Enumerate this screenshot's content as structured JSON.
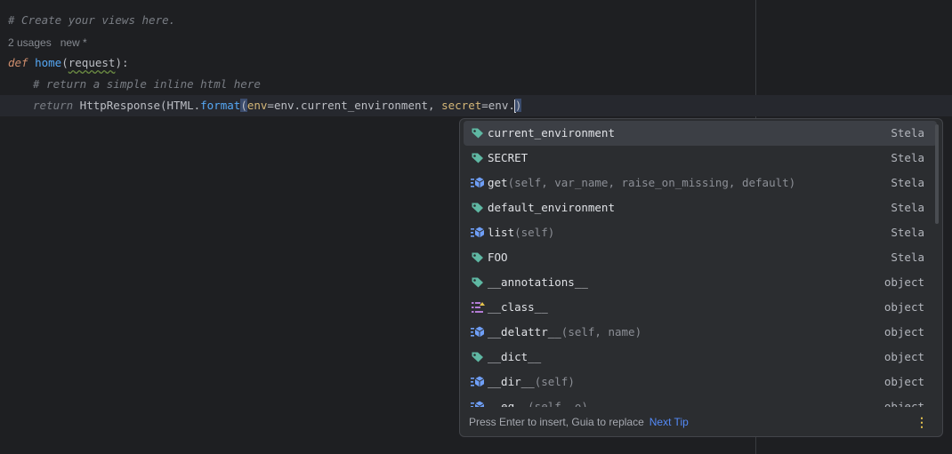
{
  "editor": {
    "line1_comment": "# Create your views here.",
    "inlay": {
      "usages": "2 usages",
      "status": "new *"
    },
    "line3": {
      "kw": "def",
      "fn": "home",
      "open": "(",
      "param": "request",
      "close": "):"
    },
    "line4_comment": "# return a simple inline html here",
    "line5": {
      "kw": "return",
      "p1": " HttpResponse(HTML.",
      "meth": "format",
      "paren": "(",
      "arg1_name": "env",
      "arg1_val": "=env.current_environment, ",
      "arg2_name": "secret",
      "arg2_val": "=env.",
      "close": ")"
    }
  },
  "completion": {
    "items": [
      {
        "name": "current_environment",
        "sig": "",
        "source": "Stela",
        "icon": "tag-icon"
      },
      {
        "name": "SECRET",
        "sig": "",
        "source": "Stela",
        "icon": "tag-icon"
      },
      {
        "name": "get",
        "sig": "(self, var_name, raise_on_missing, default)",
        "source": "Stela",
        "icon": "method-icon"
      },
      {
        "name": "default_environment",
        "sig": "",
        "source": "Stela",
        "icon": "tag-icon"
      },
      {
        "name": "list",
        "sig": "(self)",
        "source": "Stela",
        "icon": "method-icon"
      },
      {
        "name": "FOO",
        "sig": "",
        "source": "Stela",
        "icon": "tag-icon"
      },
      {
        "name": "__annotations__",
        "sig": "",
        "source": "object",
        "icon": "tag-icon"
      },
      {
        "name": "__class__",
        "sig": "",
        "source": "object",
        "icon": "class-icon"
      },
      {
        "name": "__delattr__",
        "sig": "(self, name)",
        "source": "object",
        "icon": "method-icon"
      },
      {
        "name": "__dict__",
        "sig": "",
        "source": "object",
        "icon": "tag-icon"
      },
      {
        "name": "__dir__",
        "sig": "(self)",
        "source": "object",
        "icon": "method-icon"
      },
      {
        "name": "__eq__",
        "sig": "(self, o)",
        "source": "object",
        "icon": "method-icon"
      }
    ],
    "footer": {
      "tip": "Press Enter to insert, Guia to replace",
      "next_tip": "Next Tip",
      "more": "⋮"
    }
  },
  "colors": {
    "background": "#1e1f22",
    "popup": "#2b2d30",
    "selected": "#3c3f45",
    "link": "#548af7",
    "tag": "#5fb8a3",
    "method": "#6f9ff7"
  }
}
